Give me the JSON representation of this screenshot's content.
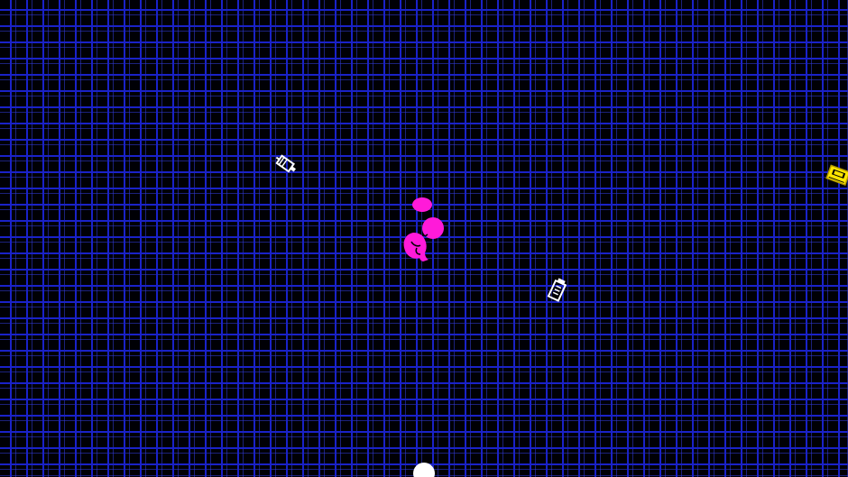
{
  "scene": {
    "background_color": "#000005",
    "grid_color": "#1a22c8"
  },
  "player": {
    "name": "fetus-sprite",
    "color": "#ff1ad9"
  },
  "items": [
    {
      "icon": "syringe-icon",
      "color": "#ffffff"
    },
    {
      "icon": "vial-icon",
      "color": "#ffffff"
    },
    {
      "icon": "cassette-icon",
      "color": "#ffe600"
    }
  ],
  "orb": {
    "color": "#ffffff"
  }
}
